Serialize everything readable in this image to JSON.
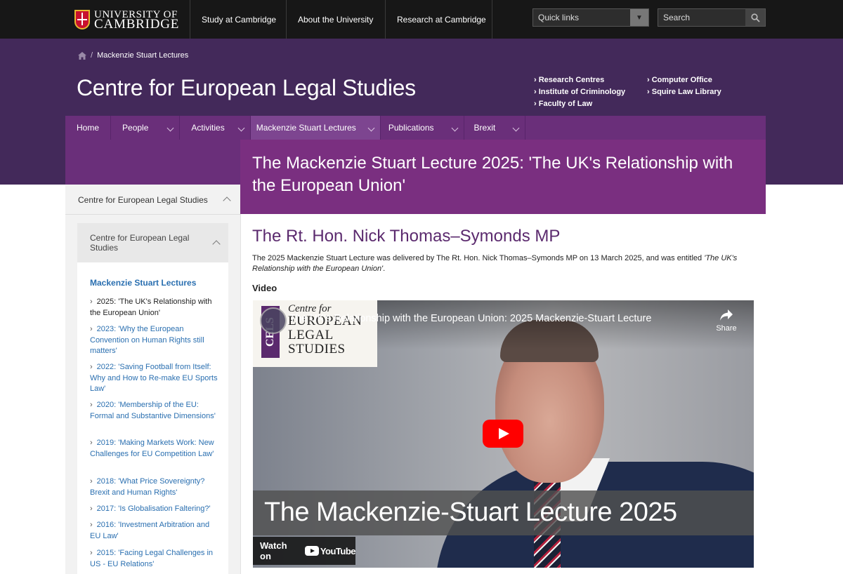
{
  "topbar": {
    "logo_line1": "UNIVERSITY OF",
    "logo_line2": "CAMBRIDGE",
    "nav": [
      "Study at Cambridge",
      "About the University",
      "Research at Cambridge"
    ],
    "quick_links": "Quick links",
    "search_placeholder": "Search"
  },
  "header": {
    "breadcrumb": "Mackenzie Stuart Lectures",
    "site_title": "Centre for European Legal Studies",
    "links": [
      "Research Centres",
      "Institute of Criminology",
      "Faculty of Law",
      "Computer Office",
      "Squire Law Library"
    ]
  },
  "secnav": [
    "Home",
    "People",
    "Activities",
    "Mackenzie Stuart Lectures",
    "Publications",
    "Brexit"
  ],
  "page": {
    "title": "The Mackenzie Stuart Lecture 2025: 'The UK's Relationship with the European Union'",
    "subtitle": "The Rt. Hon. Nick Thomas–Symonds MP",
    "intro_plain": "The 2025 Mackenzie Stuart Lecture was delivered by The Rt. Hon. Nick Thomas–Symonds MP on 13 March 2025, and was entitled ",
    "intro_italic": "'The UK's Relationship with the European Union'",
    "intro_end": ".",
    "video_label": "Video"
  },
  "sidebar": {
    "head": "Centre for European Legal Studies",
    "sub": "Centre for European Legal Studies",
    "current": "Mackenzie Stuart Lectures",
    "items": [
      "2025: 'The UK's Relationship with the European Union'",
      "2023: 'Why the European Convention on Human Rights still matters'",
      "2022: 'Saving Football from Itself: Why and How to Re-make EU Sports Law'",
      "2020: 'Membership of the EU: Formal and Substantive Dimensions'",
      "2019: 'Making Markets Work: New Challenges for EU Competition Law'",
      "2018: 'What Price Sovereignty? Brexit and Human Rights'",
      "2017: 'Is Globalisation Faltering?'",
      "2016: 'Investment Arbitration and EU Law'",
      "2015: 'Facing Legal Challenges in US - EU Relations'"
    ]
  },
  "video": {
    "title": "The UK's Relationship with the European Union: 2025 Mackenzie-Stuart Lecture",
    "share": "Share",
    "logo_small": "Centre for",
    "logo_line2": "EUROPEAN",
    "logo_line3": "LEGAL",
    "logo_line4": "STUDIES",
    "logo_mark": "CELS",
    "overlay_text": "The Mackenzie-Stuart Lecture 2025",
    "watch_on": "Watch on",
    "youtube": "YouTube"
  }
}
